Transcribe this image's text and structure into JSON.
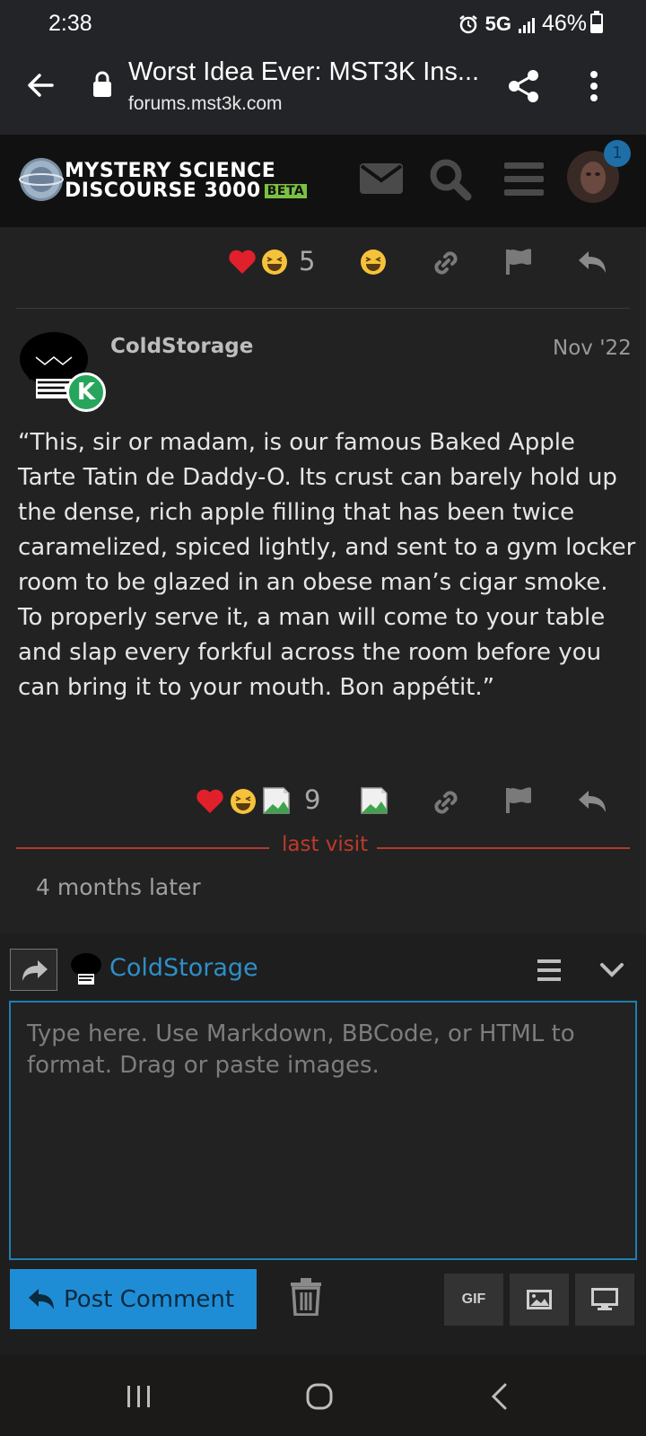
{
  "status_bar": {
    "time": "2:38",
    "network": "5G",
    "battery": "46%",
    "battery_level": 0.46
  },
  "browser": {
    "title": "Worst Idea Ever: MST3K Ins...",
    "url": "forums.mst3k.com"
  },
  "site": {
    "logo_line1": "MYSTERY SCIENCE",
    "logo_line2": "DISCOURSE 3000",
    "beta": "BETA",
    "notification_count": "1"
  },
  "prev_post": {
    "reaction_count": "5"
  },
  "post": {
    "username": "ColdStorage",
    "date": "Nov '22",
    "badge_letter": "K",
    "body": "“This, sir or madam, is our famous Baked Apple Tarte Tatin de Daddy-O. Its crust can barely hold up the dense, rich apple filling that has been twice caramelized, spiced lightly, and sent to a gym locker room to be glazed in an obese man’s cigar smoke. To properly serve it, a man will come to your table and slap every forkful across the room before you can bring it to your mouth. Bon appétit.”",
    "reaction_count": "9"
  },
  "timeline": {
    "last_visit": "last visit",
    "gap": "4 months later"
  },
  "composer": {
    "username": "ColdStorage",
    "placeholder": "Type here. Use Markdown, BBCode, or HTML to format. Drag or paste images.",
    "post_label": "Post Comment",
    "gif_label": "GIF"
  },
  "colors": {
    "accent": "#1f8dd6",
    "link": "#2e8fc7",
    "last_visit": "#c0392b",
    "beta": "#7bc043"
  }
}
